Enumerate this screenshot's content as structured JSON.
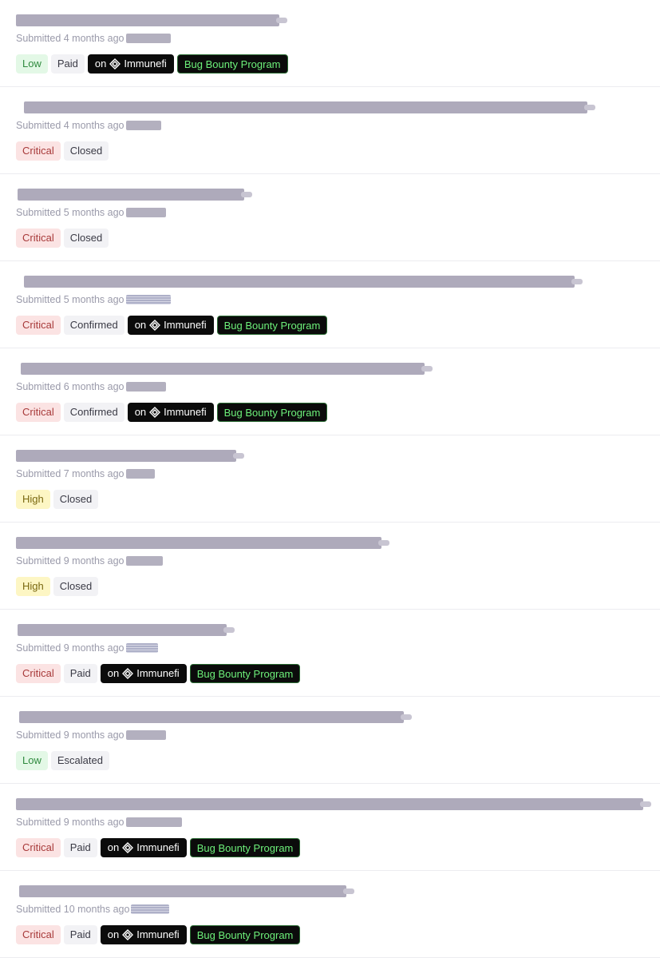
{
  "reports": [
    {
      "submitted": "Submitted 4 months ago",
      "severity": "Low",
      "status": "Paid",
      "platform_prefix": "on",
      "platform_name": "Immunefi",
      "program": "Bug Bounty Program"
    },
    {
      "submitted": "Submitted 4 months ago",
      "severity": "Critical",
      "status": "Closed"
    },
    {
      "submitted": "Submitted 5 months ago",
      "severity": "Critical",
      "status": "Closed"
    },
    {
      "submitted": "Submitted 5 months ago",
      "severity": "Critical",
      "status": "Confirmed",
      "platform_prefix": "on",
      "platform_name": "Immunefi",
      "program": "Bug Bounty Program"
    },
    {
      "submitted": "Submitted 6 months ago",
      "severity": "Critical",
      "status": "Confirmed",
      "platform_prefix": "on",
      "platform_name": "Immunefi",
      "program": "Bug Bounty Program"
    },
    {
      "submitted": "Submitted 7 months ago",
      "severity": "High",
      "status": "Closed"
    },
    {
      "submitted": "Submitted 9 months ago",
      "severity": "High",
      "status": "Closed"
    },
    {
      "submitted": "Submitted 9 months ago",
      "severity": "Critical",
      "status": "Paid",
      "platform_prefix": "on",
      "platform_name": "Immunefi",
      "program": "Bug Bounty Program"
    },
    {
      "submitted": "Submitted 9 months ago",
      "severity": "Low",
      "status": "Escalated"
    },
    {
      "submitted": "Submitted 9 months ago",
      "severity": "Critical",
      "status": "Paid",
      "platform_prefix": "on",
      "platform_name": "Immunefi",
      "program": "Bug Bounty Program"
    },
    {
      "submitted": "Submitted 10 months ago",
      "severity": "Critical",
      "status": "Paid",
      "platform_prefix": "on",
      "platform_name": "Immunefi",
      "program": "Bug Bounty Program"
    }
  ],
  "colors": {
    "severity_low_bg": "#e3f8e6",
    "severity_critical_bg": "#fbe3e3",
    "severity_high_bg": "#fdf6c4",
    "platform_bg": "#0b0b0b",
    "program_text": "#6df07a"
  },
  "icons": {
    "platform_logo": "immunefi-logo-icon"
  }
}
